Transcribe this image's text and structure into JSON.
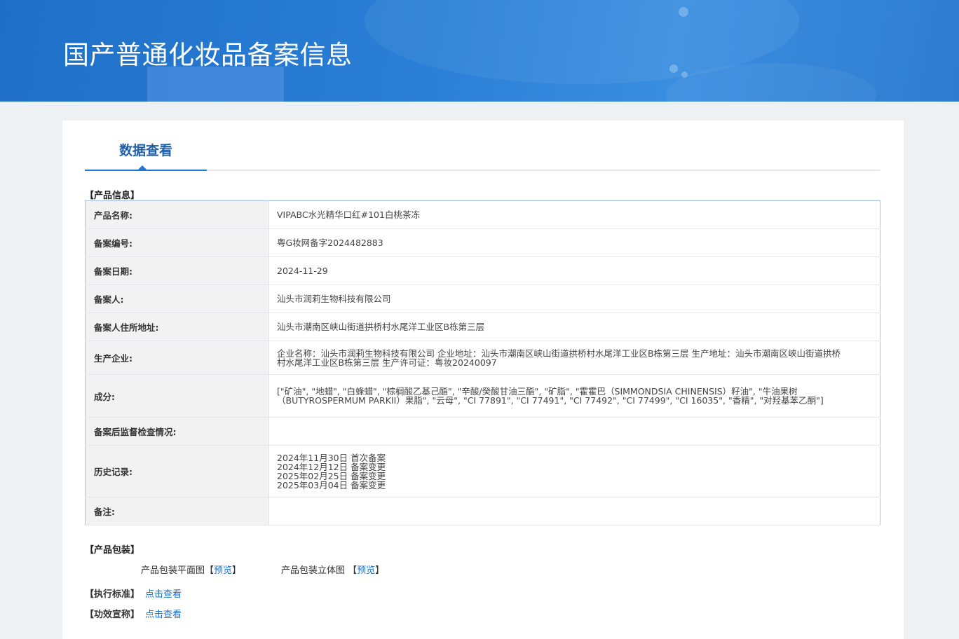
{
  "header": {
    "title": "国产普通化妆品备案信息"
  },
  "tab": {
    "label": "数据查看"
  },
  "product_section": {
    "title": "【产品信息】"
  },
  "rows": [
    {
      "label": "产品名称:",
      "value": "VIPABC水光精华口红#101白桃茶冻"
    },
    {
      "label": "备案编号:",
      "value": "粤G妆网备字2024482883"
    },
    {
      "label": "备案日期:",
      "value": "2024-11-29"
    },
    {
      "label": "备案人:",
      "value": "汕头市润莉生物科技有限公司"
    },
    {
      "label": "备案人住所地址:",
      "value": "汕头市潮南区峡山街道拱桥村水尾洋工业区B栋第三层"
    },
    {
      "label": "生产企业:",
      "value": "企业名称：汕头市润莉生物科技有限公司 企业地址：汕头市潮南区峡山街道拱桥村水尾洋工业区B栋第三层 生产地址：汕头市潮南区峡山街道拱桥村水尾洋工业区B栋第三层 生产许可证：粤妆20240097"
    },
    {
      "label": "成分:",
      "value": "[\"矿油\", \"地蜡\", \"白蜂蜡\", \"棕榈酸乙基己酯\", \"辛酸/癸酸甘油三酯\", \"矿脂\", \"霍霍巴（SIMMONDSIA CHINENSIS）籽油\", \"牛油果树（BUTYROSPERMUM PARKII）果脂\", \"云母\", \"CI 77891\", \"CI 77491\", \"CI 77492\", \"CI 77499\", \"CI 16035\", \"香精\", \"对羟基苯乙酮\"]"
    },
    {
      "label": "备案后监督检查情况:",
      "value": ""
    },
    {
      "label": "历史记录:",
      "history": [
        "2024年11月30日 首次备案",
        "2024年12月12日 备案变更",
        "2025年02月25日 备案变更",
        "2025年03月04日 备案变更"
      ]
    },
    {
      "label": "备注:",
      "value": ""
    }
  ],
  "packaging": {
    "title": "【产品包装】",
    "flat_label": "产品包装平面图",
    "flat_link": "预览",
    "solid_label": "产品包装立体图",
    "solid_link": "预览"
  },
  "standard": {
    "title": "【执行标准】",
    "link": "点击查看"
  },
  "efficacy": {
    "title": "【功效宣称】",
    "link": "点击查看"
  }
}
